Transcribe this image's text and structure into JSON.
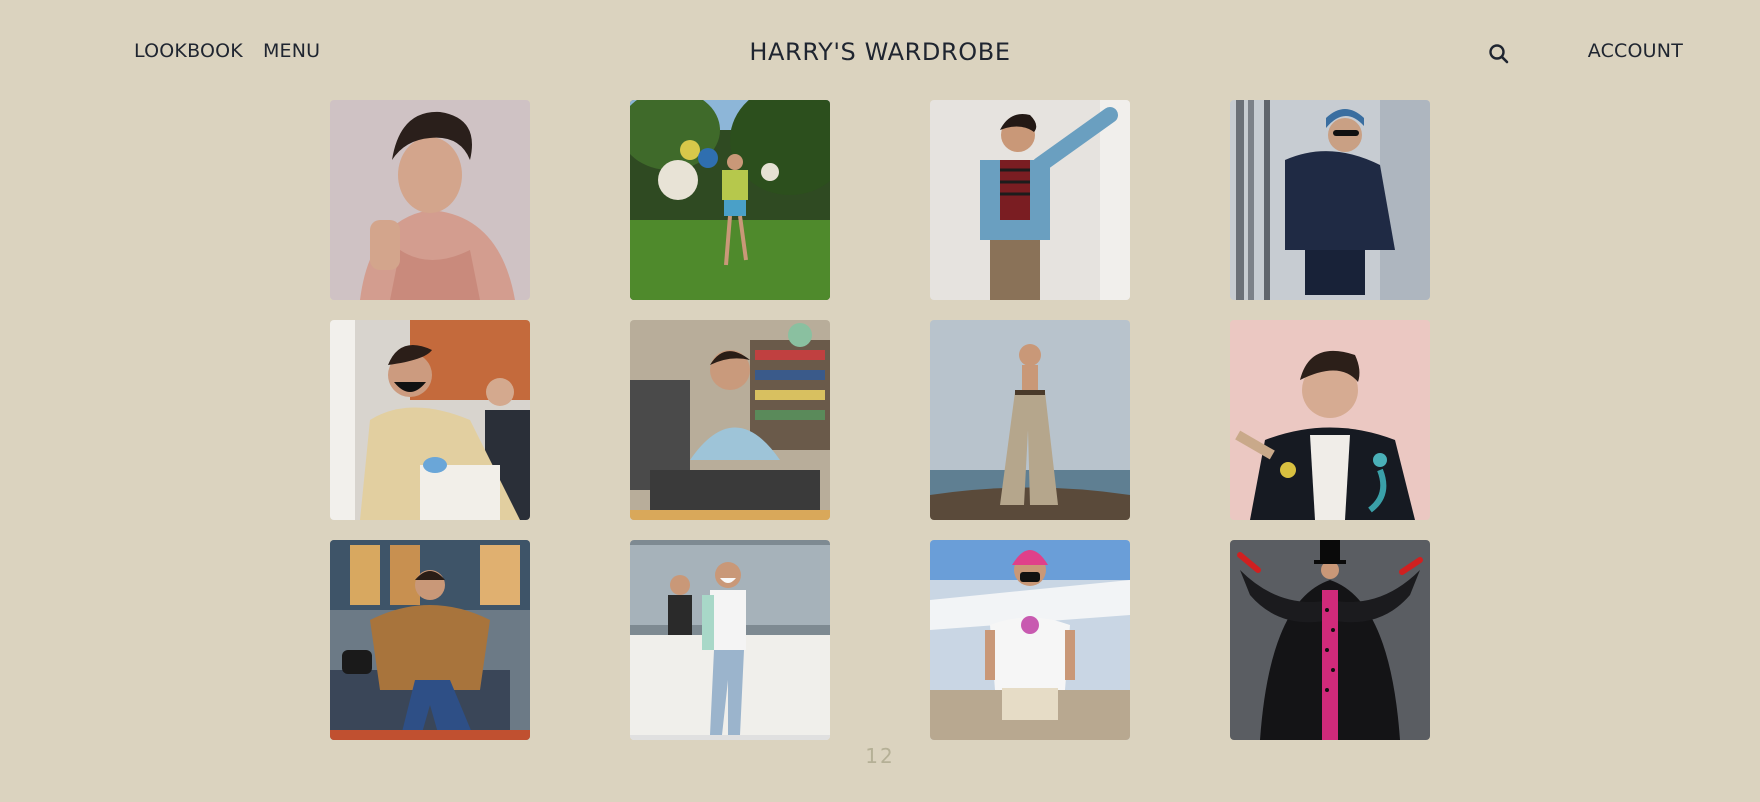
{
  "header": {
    "nav_left": [
      {
        "label": "LOOKBOOK",
        "name": "nav-lookbook"
      },
      {
        "label": "MENU",
        "name": "nav-menu"
      }
    ],
    "title": "HARRY'S WARDROBE",
    "search_icon": "search-icon",
    "account_label": "ACCOUNT"
  },
  "gallery": {
    "items": [
      {
        "name": "outfit-photo-pink-ruffled-shirt",
        "icon": "photo-thumbnail"
      },
      {
        "name": "outfit-photo-balloons-on-lawn",
        "icon": "photo-thumbnail"
      },
      {
        "name": "outfit-photo-blue-blazer-striped-shirt",
        "icon": "photo-thumbnail"
      },
      {
        "name": "outfit-photo-navy-hoodie-street",
        "icon": "photo-thumbnail"
      },
      {
        "name": "outfit-photo-beige-coat-mask",
        "icon": "photo-thumbnail"
      },
      {
        "name": "outfit-photo-blue-sweater-studio",
        "icon": "photo-thumbnail"
      },
      {
        "name": "outfit-photo-wide-trousers-seaside",
        "icon": "photo-thumbnail"
      },
      {
        "name": "outfit-photo-embroidered-cardigan",
        "icon": "photo-thumbnail"
      },
      {
        "name": "outfit-photo-fur-coat-flared-jeans",
        "icon": "photo-thumbnail"
      },
      {
        "name": "outfit-photo-ripped-jeans-street",
        "icon": "photo-thumbnail"
      },
      {
        "name": "outfit-photo-pink-beanie-tee",
        "icon": "photo-thumbnail"
      },
      {
        "name": "outfit-photo-black-gown-top-hat",
        "icon": "photo-thumbnail"
      }
    ]
  },
  "footer": {
    "count": "12"
  },
  "colors": {
    "background": "#dbd3bf",
    "text": "#1f2530",
    "count_text": "#b5b096"
  }
}
